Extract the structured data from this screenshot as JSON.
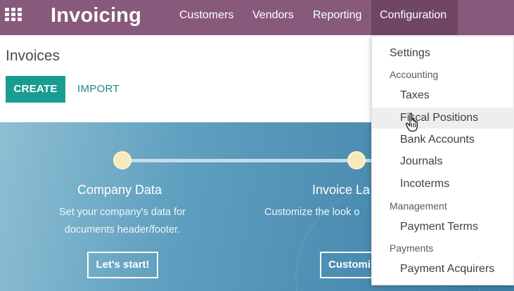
{
  "navbar": {
    "brand": "Invoicing",
    "menu": [
      {
        "label": "Customers"
      },
      {
        "label": "Vendors"
      },
      {
        "label": "Reporting"
      },
      {
        "label": "Configuration"
      }
    ],
    "color": "#875a7b",
    "active_color": "#6f4664"
  },
  "control_panel": {
    "title": "Invoices",
    "create_label": "CREATE",
    "import_label": "IMPORT",
    "accent": "#1a9c90"
  },
  "onboarding": {
    "steps": [
      {
        "title": "Company Data",
        "desc_1": "Set your company's data for",
        "desc_2": "documents header/footer.",
        "button": "Let's start!"
      },
      {
        "title": "Invoice La",
        "desc_1": "Customize the look o",
        "desc_2": "",
        "button": "Customi"
      }
    ]
  },
  "dropdown": {
    "settings": "Settings",
    "accounting_header": "Accounting",
    "accounting_items": [
      "Taxes",
      "Fiscal Positions",
      "Bank Accounts",
      "Journals",
      "Incoterms"
    ],
    "management_header": "Management",
    "management_items": [
      "Payment Terms"
    ],
    "payments_header": "Payments",
    "payments_items": [
      "Payment Acquirers"
    ],
    "hovered_item": "Fiscal Positions"
  },
  "icons": {
    "apps": "apps-grid-icon",
    "cursor": "hand-pointer-icon"
  }
}
